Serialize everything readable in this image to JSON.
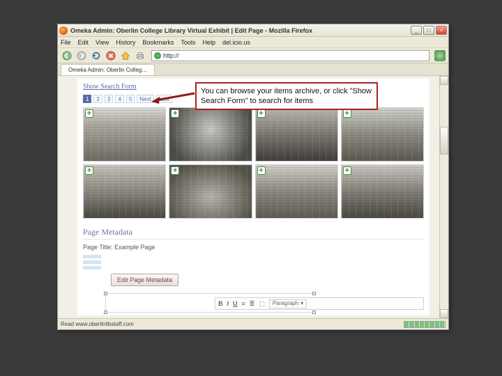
{
  "window": {
    "title": "Omeka Admin: Oberlin College Library Virtual Exhibit | Edit Page - Mozilla Firefox"
  },
  "menu": {
    "file": "File",
    "edit": "Edit",
    "view": "View",
    "history": "History",
    "bookmarks": "Bookmarks",
    "tools": "Tools",
    "help": "Help",
    "delicious": "del.icio.us"
  },
  "url": {
    "value": "http://"
  },
  "tab": {
    "label": "Omeka Admin: Oberlin Colleg…"
  },
  "page": {
    "show_search": "Show Search Form",
    "pager": {
      "p1": "1",
      "p2": "2",
      "p3": "3",
      "p4": "4",
      "p5": "5",
      "next": "Next",
      "last": "Last"
    },
    "section_meta": "Page Metadata",
    "page_title_label": "Page Title: Example Page",
    "edit_meta_btn": "Edit Page Metadata"
  },
  "editor": {
    "bold": "B",
    "italic": "I",
    "underline": "U",
    "select": "Paragraph"
  },
  "status": {
    "text": "Read www.oberlinlibstaff.com"
  },
  "callout": {
    "text": "You can browse your items archive, or click \"Show Search Form\" to search for items"
  }
}
